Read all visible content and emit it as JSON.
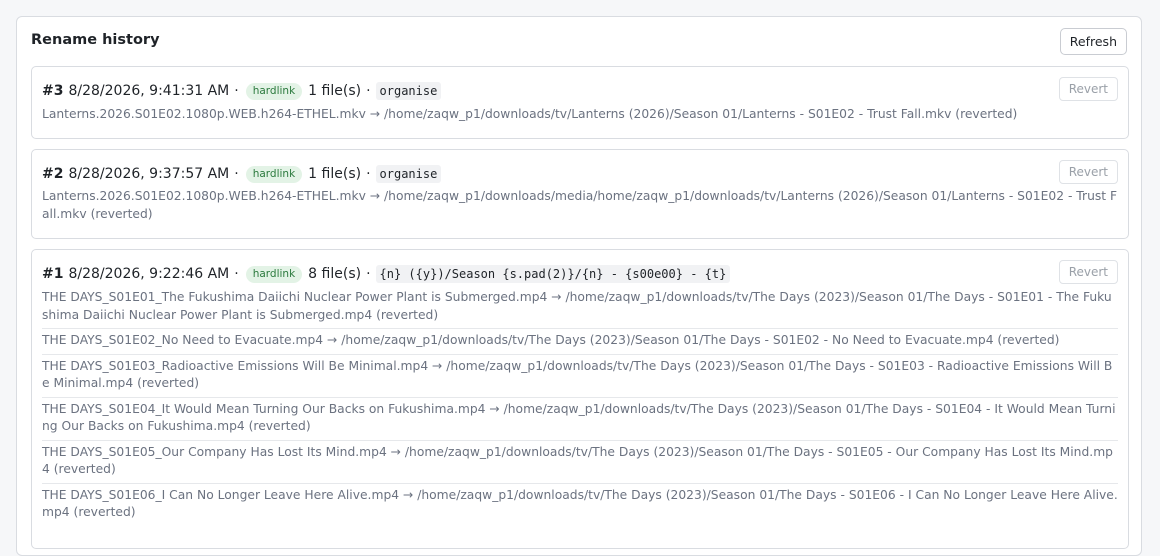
{
  "panel": {
    "title": "Rename history",
    "refresh_label": "Refresh"
  },
  "entries": [
    {
      "number": "#3",
      "timestamp": "8/28/2026, 9:41:31 AM",
      "separator": "·",
      "mode_badge": "hardlink",
      "file_count": "1 file(s)",
      "template": "organise",
      "revert_label": "Revert",
      "files": [
        "Lanterns.2026.S01E02.1080p.WEB.h264-ETHEL.mkv → /home/zaqw_p1/downloads/tv/Lanterns (2026)/Season 01/Lanterns - S01E02 - Trust Fall.mkv (reverted)"
      ]
    },
    {
      "number": "#2",
      "timestamp": "8/28/2026, 9:37:57 AM",
      "separator": "·",
      "mode_badge": "hardlink",
      "file_count": "1 file(s)",
      "template": "organise",
      "revert_label": "Revert",
      "files": [
        "Lanterns.2026.S01E02.1080p.WEB.h264-ETHEL.mkv → /home/zaqw_p1/downloads/media/home/zaqw_p1/downloads/tv/Lanterns (2026)/Season 01/Lanterns - S01E02 - Trust Fall.mkv (reverted)"
      ]
    },
    {
      "number": "#1",
      "timestamp": "8/28/2026, 9:22:46 AM",
      "separator": "·",
      "mode_badge": "hardlink",
      "file_count": "8 file(s)",
      "template": "{n} ({y})/Season {s.pad(2)}/{n} - {s00e00} - {t}",
      "revert_label": "Revert",
      "files": [
        "THE DAYS_S01E01_The Fukushima Daiichi Nuclear Power Plant is Submerged.mp4 → /home/zaqw_p1/downloads/tv/The Days (2023)/Season 01/The Days - S01E01 - The Fukushima Daiichi Nuclear Power Plant is Submerged.mp4 (reverted)",
        "THE DAYS_S01E02_No Need to Evacuate.mp4 → /home/zaqw_p1/downloads/tv/The Days (2023)/Season 01/The Days - S01E02 - No Need to Evacuate.mp4 (reverted)",
        "THE DAYS_S01E03_Radioactive Emissions Will Be Minimal.mp4 → /home/zaqw_p1/downloads/tv/The Days (2023)/Season 01/The Days - S01E03 - Radioactive Emissions Will Be Minimal.mp4 (reverted)",
        "THE DAYS_S01E04_It Would Mean Turning Our Backs on Fukushima.mp4 → /home/zaqw_p1/downloads/tv/The Days (2023)/Season 01/The Days - S01E04 - It Would Mean Turning Our Backs on Fukushima.mp4 (reverted)",
        "THE DAYS_S01E05_Our Company Has Lost Its Mind.mp4 → /home/zaqw_p1/downloads/tv/The Days (2023)/Season 01/The Days - S01E05 - Our Company Has Lost Its Mind.mp4 (reverted)",
        "THE DAYS_S01E06_I Can No Longer Leave Here Alive.mp4 → /home/zaqw_p1/downloads/tv/The Days (2023)/Season 01/The Days - S01E06 - I Can No Longer Leave Here Alive.mp4 (reverted)"
      ]
    }
  ]
}
